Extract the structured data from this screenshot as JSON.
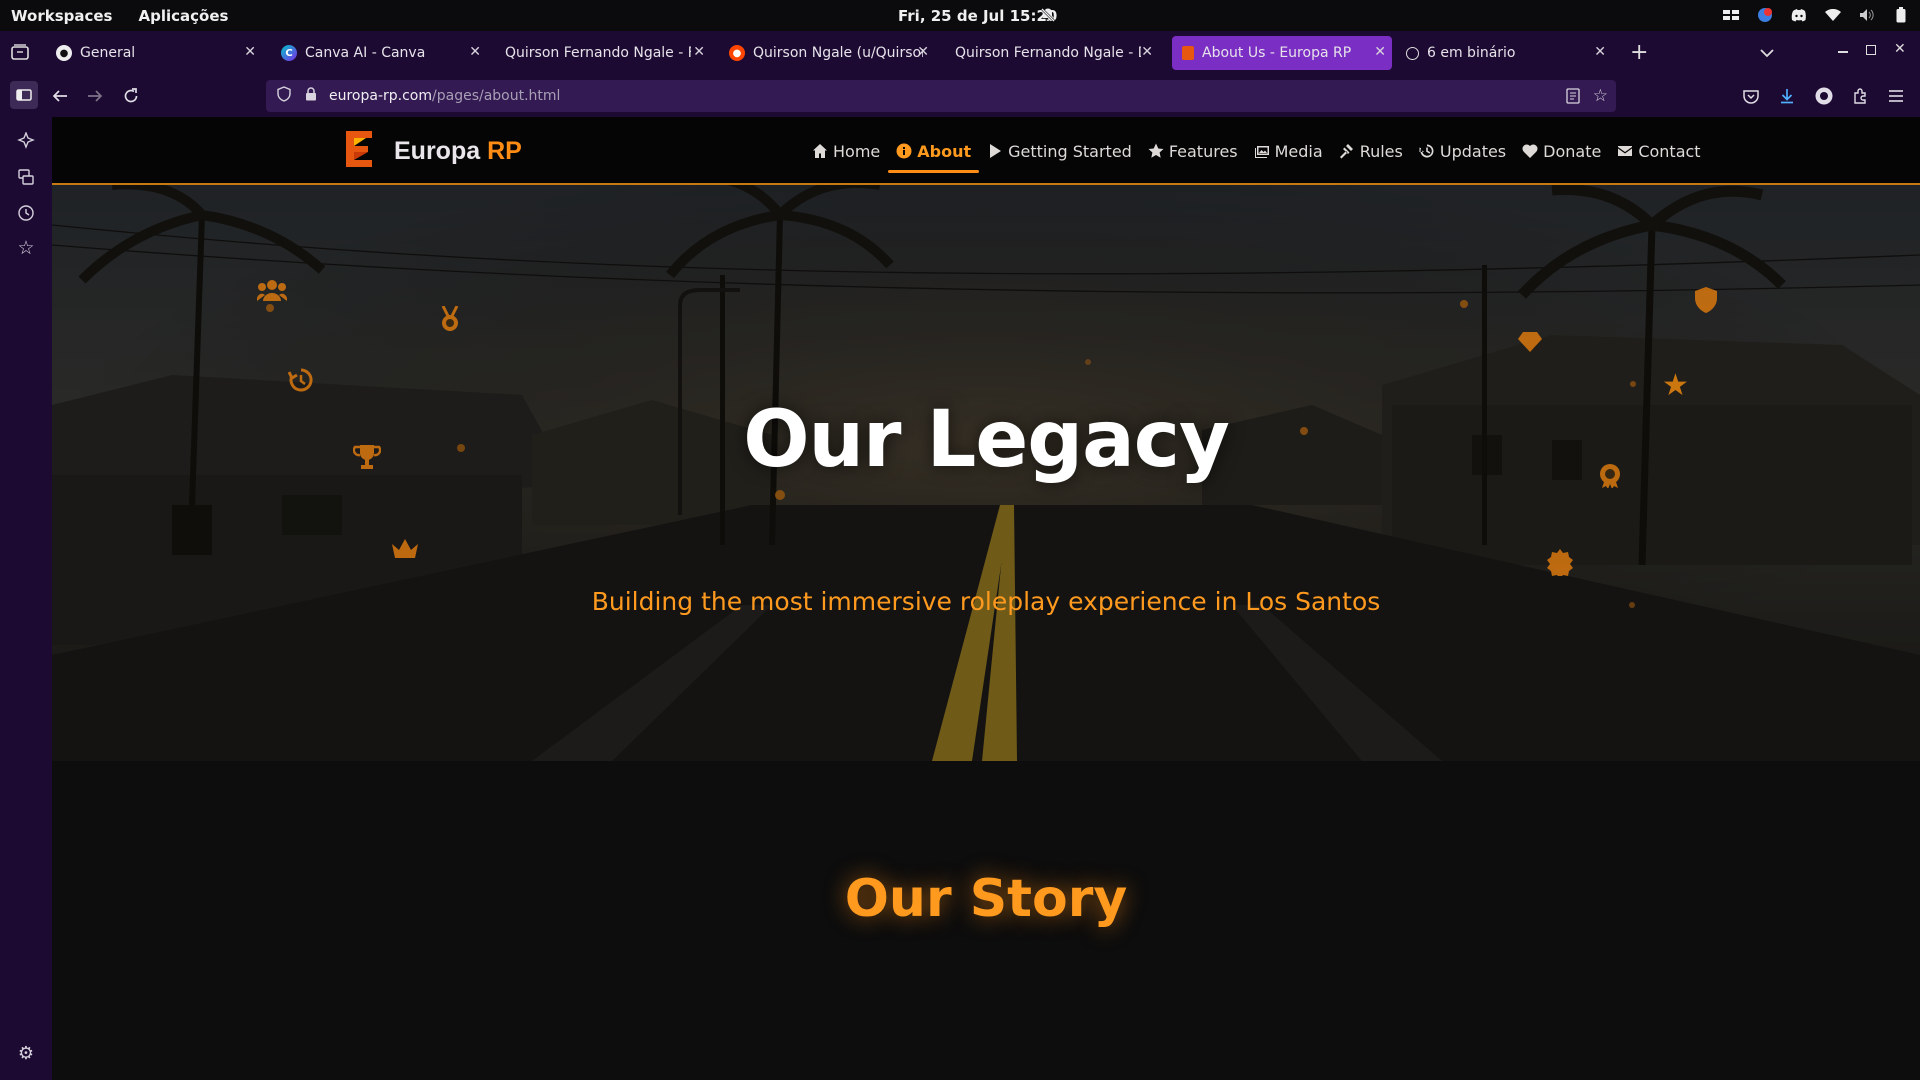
{
  "os_bar": {
    "workspaces": "Workspaces",
    "apps": "Aplicações",
    "clock": "Fri, 25 de Jul  15:20"
  },
  "tabs": [
    {
      "title": "General",
      "favicon": "github-icon"
    },
    {
      "title": "Canva AI - Canva",
      "favicon": "canva-icon"
    },
    {
      "title": "Quirson Fernando Ngale - Full S",
      "favicon": "none"
    },
    {
      "title": "Quirson Ngale (u/Quirson_N",
      "favicon": "reddit-icon"
    },
    {
      "title": "Quirson Fernando Ngale - Desen",
      "favicon": "none"
    },
    {
      "title": "About Us - Europa RP",
      "favicon": "europa-icon",
      "active": true
    },
    {
      "title": "6 em binário",
      "favicon": "chatgpt-icon"
    }
  ],
  "url": {
    "host": "europa-rp.com",
    "path": "/pages/about.html"
  },
  "site": {
    "brand": "Europa",
    "brand_accent": "RP",
    "accent_color": "#ff8c14",
    "menu": [
      {
        "label": "Home",
        "icon": "home-icon"
      },
      {
        "label": "About",
        "icon": "info-icon",
        "active": true
      },
      {
        "label": "Getting Started",
        "icon": "play-icon"
      },
      {
        "label": "Features",
        "icon": "star-icon"
      },
      {
        "label": "Media",
        "icon": "images-icon"
      },
      {
        "label": "Rules",
        "icon": "gavel-icon"
      },
      {
        "label": "Updates",
        "icon": "history-icon"
      },
      {
        "label": "Donate",
        "icon": "heart-icon"
      },
      {
        "label": "Contact",
        "icon": "envelope-icon"
      }
    ]
  },
  "hero": {
    "title": "Our Legacy",
    "subtitle": "Building the most immersive roleplay experience in Los Santos"
  },
  "story": {
    "title": "Our Story"
  }
}
